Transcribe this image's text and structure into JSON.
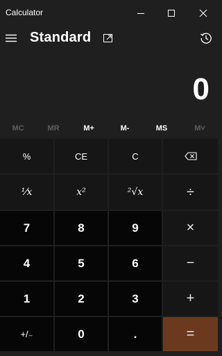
{
  "window": {
    "title": "Calculator"
  },
  "header": {
    "mode": "Standard",
    "menu_icon": "hamburger-icon",
    "keep_on_top_icon": "keep-on-top-icon",
    "history_icon": "history-icon"
  },
  "display": {
    "value": "0"
  },
  "memory": [
    "MC",
    "MR",
    "M+",
    "M-",
    "MS",
    "M˅"
  ],
  "keys": {
    "percent": "%",
    "ce": "CE",
    "c": "C",
    "reciprocal": "⅟x",
    "square": "x²",
    "sqrt": "²√x",
    "divide": "÷",
    "n7": "7",
    "n8": "8",
    "n9": "9",
    "multiply": "×",
    "n4": "4",
    "n5": "5",
    "n6": "6",
    "minus": "−",
    "n1": "1",
    "n2": "2",
    "n3": "3",
    "plus": "+",
    "negate": "+/₋",
    "n0": "0",
    "decimal": ".",
    "equals": "="
  },
  "colors": {
    "background": "#1f1f1f",
    "function_key": "#161616",
    "number_key": "#060606",
    "equals_key": "#6b3a1e",
    "memory_disabled": "#5f5f5f"
  }
}
